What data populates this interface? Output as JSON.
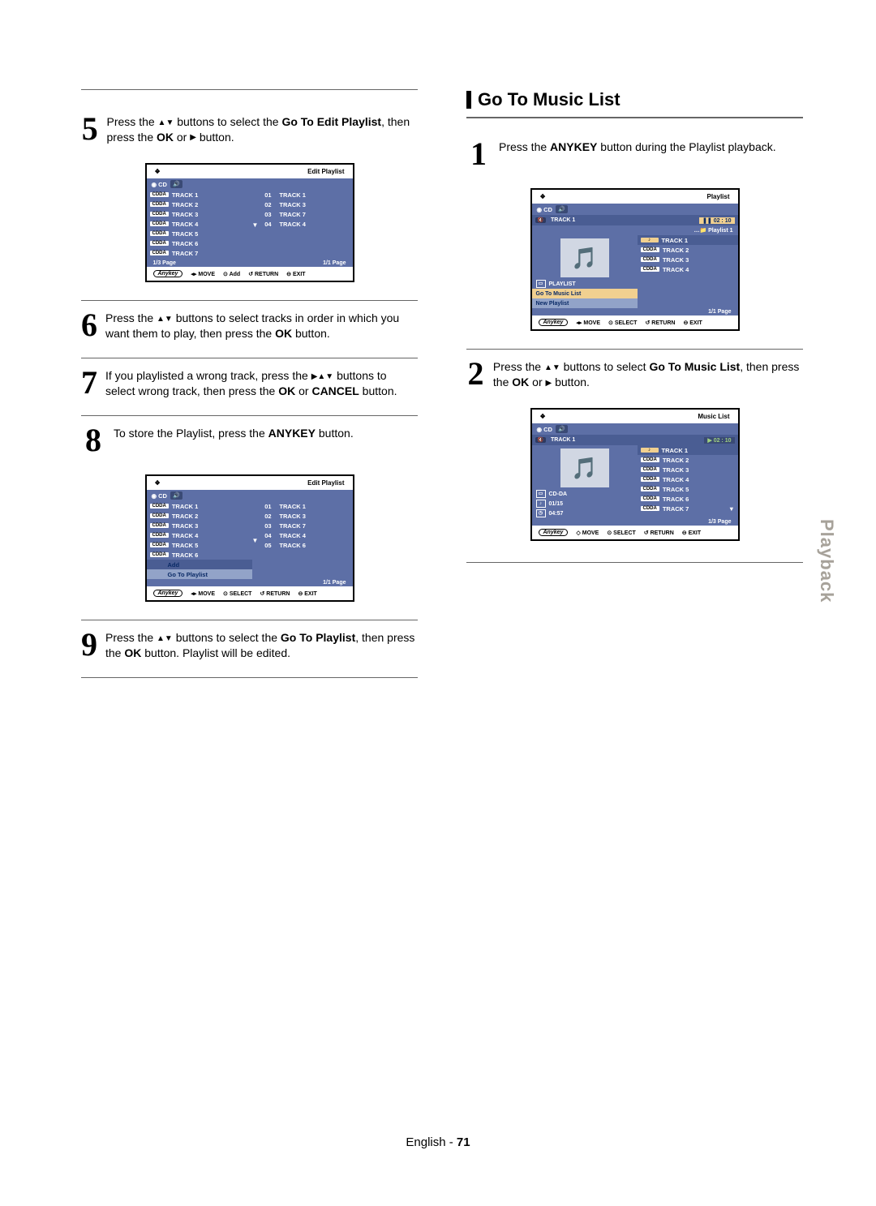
{
  "left": {
    "step5": {
      "num": "5",
      "text_a": "Press the ",
      "text_b": " buttons to select the ",
      "bold1": "Go To Edit Playlist",
      "text_c": ", then press the ",
      "bold2": "OK",
      "text_d": " or ",
      "text_e": " button."
    },
    "fig1": {
      "title": "Edit Playlist",
      "cd": "CD",
      "left_tracks": [
        "TRACK 1",
        "TRACK 2",
        "TRACK 3",
        "TRACK 4",
        "TRACK 5",
        "TRACK 6",
        "TRACK 7"
      ],
      "right_nums": [
        "01",
        "02",
        "03",
        "04"
      ],
      "right_tracks": [
        "TRACK 1",
        "TRACK 3",
        "TRACK 7",
        "TRACK 4"
      ],
      "page_l": "1/3 Page",
      "page_r": "1/1 Page",
      "foot_move": "MOVE",
      "foot_add": "Add",
      "foot_return": "RETURN",
      "foot_exit": "EXIT",
      "tag": "CDDA",
      "anykey": "Anykey"
    },
    "step6": {
      "num": "6",
      "text_a": "Press the ",
      "text_b": " buttons to select tracks in order in which you want them to play, then press the ",
      "bold1": "OK",
      "text_c": " button."
    },
    "step7": {
      "num": "7",
      "text_a": "If you playlisted a wrong track, press the ",
      "text_b": " buttons to select wrong track, then press the ",
      "bold1": "OK",
      "text_c": " or ",
      "bold2": "CANCEL",
      "text_d": " button."
    },
    "step8": {
      "num": "8",
      "text_a": "To store the Playlist, press the ",
      "bold1": "ANYKEY",
      "text_b": " button."
    },
    "fig2": {
      "title": "Edit Playlist",
      "cd": "CD",
      "left_tracks": [
        "TRACK 1",
        "TRACK 2",
        "TRACK 3",
        "TRACK 4",
        "TRACK 5",
        "TRACK 6"
      ],
      "add": "Add",
      "goto": "Go To Playlist",
      "right_nums": [
        "01",
        "02",
        "03",
        "04",
        "05"
      ],
      "right_tracks": [
        "TRACK 1",
        "TRACK 3",
        "TRACK 7",
        "TRACK 4",
        "TRACK 6"
      ],
      "page_r": "1/1 Page",
      "foot_move": "MOVE",
      "foot_select": "SELECT",
      "foot_return": "RETURN",
      "foot_exit": "EXIT",
      "tag": "CDDA",
      "anykey": "Anykey"
    },
    "step9": {
      "num": "9",
      "text_a": "Press the ",
      "text_b": " buttons to select the ",
      "bold1": "Go To Playlist",
      "text_c": ", then press the ",
      "bold2": "OK",
      "text_d": " button. Playlist will be edited."
    }
  },
  "right": {
    "section_title": "Go To Music List",
    "step1": {
      "num": "1",
      "text_a": "Press the ",
      "bold1": "ANYKEY",
      "text_b": " button during the Playlist playback."
    },
    "fig3": {
      "title": "Playlist",
      "cd": "CD",
      "now_track": "TRACK  1",
      "now_time": "02 : 10",
      "sub": "Playlist 1",
      "left_playlist": "PLAYLIST",
      "goto": "Go To Music List",
      "newpl": "New Playlist",
      "right_tracks": [
        "TRACK 1",
        "TRACK 2",
        "TRACK 3",
        "TRACK 4"
      ],
      "page_r": "1/1 Page",
      "foot_move": "MOVE",
      "foot_select": "SELECT",
      "foot_return": "RETURN",
      "foot_exit": "EXIT",
      "tag": "CDDA",
      "anykey": "Anykey"
    },
    "step2": {
      "num": "2",
      "text_a": "Press the ",
      "text_b": " buttons to select ",
      "bold1": "Go To Music List",
      "text_c": ", then press the ",
      "bold2": "OK",
      "text_d": " or ",
      "text_e": " button."
    },
    "fig4": {
      "title": "Music List",
      "cd": "CD",
      "now_track": "TRACK  1",
      "now_time": "02 : 10",
      "cdda": "CD-DA",
      "idx": "01/15",
      "elapsed": "04:57",
      "right_tracks": [
        "TRACK 1",
        "TRACK 2",
        "TRACK 3",
        "TRACK 4",
        "TRACK 5",
        "TRACK 6",
        "TRACK 7"
      ],
      "page_r": "1/3 Page",
      "foot_move": "MOVE",
      "foot_select": "SELECT",
      "foot_return": "RETURN",
      "foot_exit": "EXIT",
      "tag": "CDDA",
      "anykey": "Anykey"
    }
  },
  "side_tab": "Playback",
  "footer_lang": "English - ",
  "footer_page": "71"
}
